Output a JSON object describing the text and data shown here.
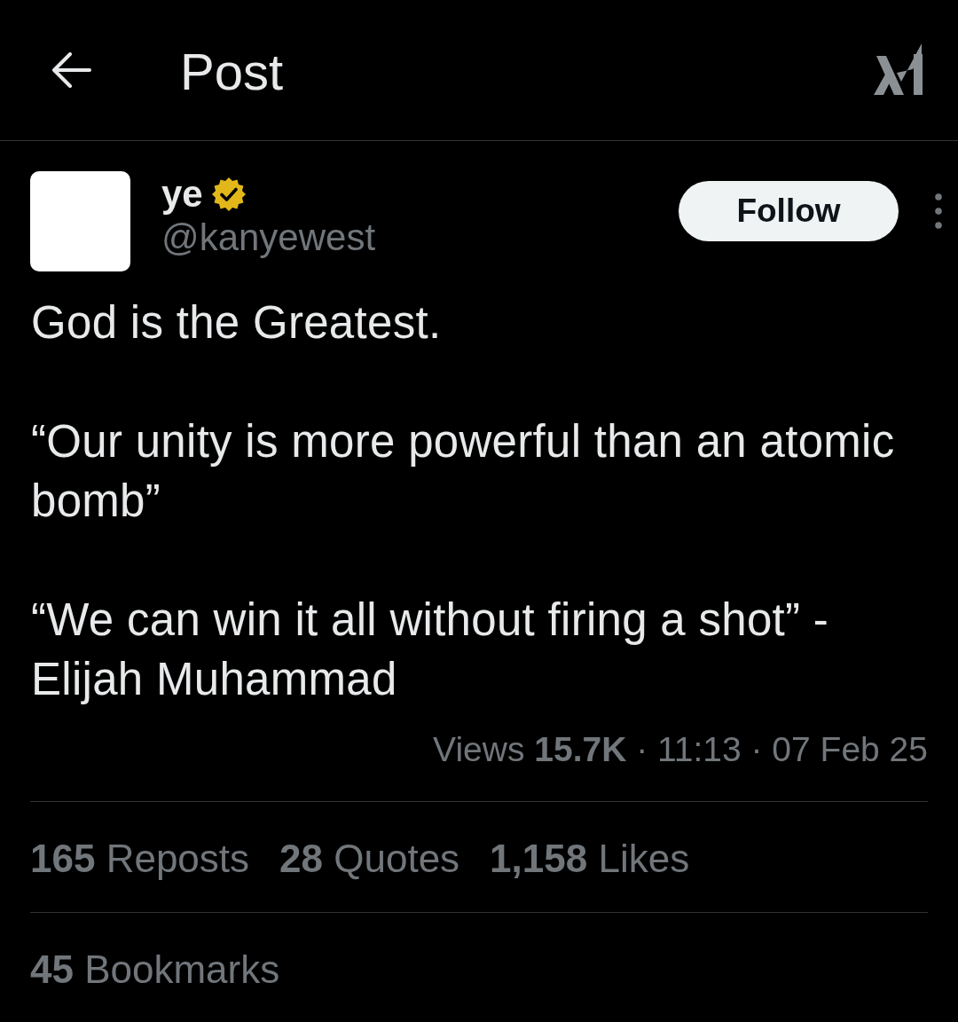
{
  "header": {
    "title": "Post"
  },
  "post": {
    "author": {
      "name": "ye",
      "verified": true,
      "handle": "@kanyewest"
    },
    "follow_button": "Follow",
    "paragraphs": [
      "God is the Greatest.",
      "“Our unity is more powerful than an atomic bomb”",
      "“We can win it all without firing a shot” - Elijah Muhammad"
    ],
    "meta": "Views **15.7K** · 11:13 · 07 Feb 25",
    "stats": [
      "**165** Reposts",
      "**28** Quotes",
      "**1,158** Likes"
    ],
    "bookmarks": "**45** Bookmarks"
  }
}
